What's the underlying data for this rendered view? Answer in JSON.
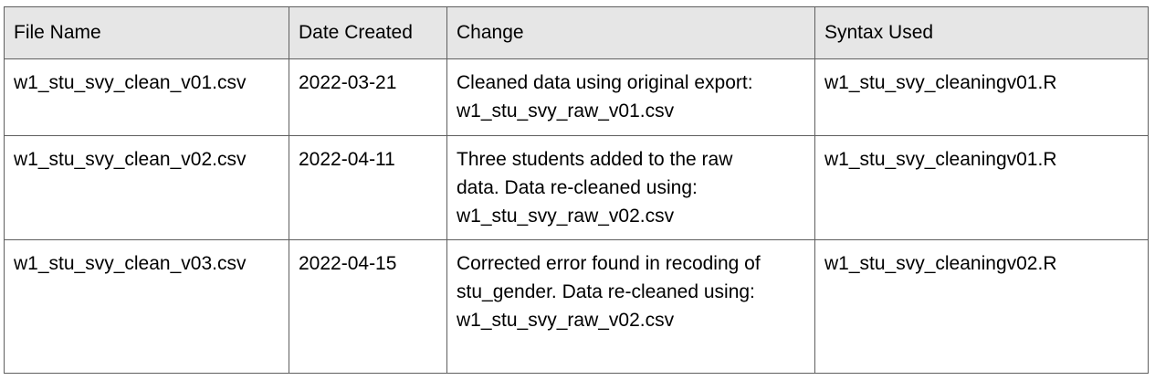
{
  "table": {
    "headers": [
      "File Name",
      "Date Created",
      "Change",
      "Syntax Used"
    ],
    "rows": [
      {
        "file_name": "w1_stu_svy_clean_v01.csv",
        "date_created": "2022-03-21",
        "change": "Cleaned data using original export:\nw1_stu_svy_raw_v01.csv",
        "syntax_used": "w1_stu_svy_cleaningv01.R"
      },
      {
        "file_name": "w1_stu_svy_clean_v02.csv",
        "date_created": "2022-04-11",
        "change": "Three students added to the raw\ndata. Data re-cleaned using:\nw1_stu_svy_raw_v02.csv",
        "syntax_used": "w1_stu_svy_cleaningv01.R"
      },
      {
        "file_name": "w1_stu_svy_clean_v03.csv",
        "date_created": "2022-04-15",
        "change": "Corrected error found in recoding of\nstu_gender. Data re-cleaned using:\nw1_stu_svy_raw_v02.csv",
        "syntax_used": "w1_stu_svy_cleaningv02.R"
      }
    ]
  }
}
